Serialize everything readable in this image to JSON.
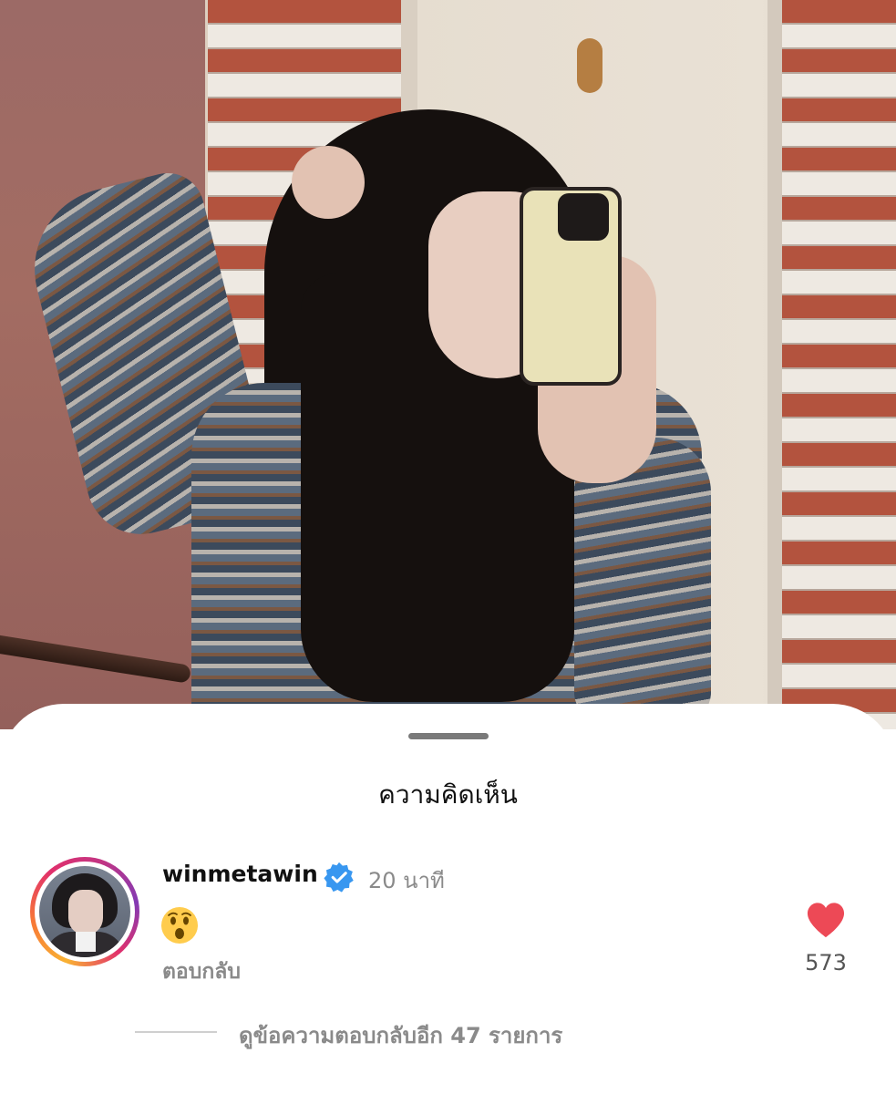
{
  "sheet": {
    "title": "ความคิดเห็น"
  },
  "comment": {
    "username": "winmetawin",
    "verified_icon": "verified-badge-icon",
    "timestamp": "20 นาที",
    "text_emoji": "astonished-face-emoji",
    "reply_label": "ตอบกลับ",
    "like_icon": "heart-icon",
    "like_count": "573"
  },
  "view_replies": {
    "label": "ดูข้อความตอบกลับอีก 47 รายการ"
  },
  "colors": {
    "like_red": "#ed4956",
    "verified_blue": "#3897f0",
    "muted_text": "#8a8a8a"
  }
}
